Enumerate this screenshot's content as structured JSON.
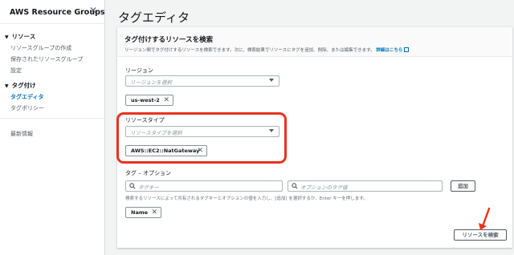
{
  "sidebar": {
    "title": "AWS Resource Groups",
    "sections": [
      {
        "label": "リソース",
        "items": [
          "リソースグループの作成",
          "保存されたリソースグループ",
          "設定"
        ]
      },
      {
        "label": "タグ付け",
        "items": [
          "タグエディタ",
          "タグポリシー"
        ]
      }
    ],
    "footer_item": "最新情報"
  },
  "page": {
    "title": "タグエディタ"
  },
  "panel": {
    "title": "タグ付けするリソースを検索",
    "description": "リージョン間でタグ付けするリソースを検索できます。次に、検索結果でリソースにタグを追加、削除、または編集できます。",
    "link": "詳細はこちら"
  },
  "region": {
    "label": "リージョン",
    "placeholder": "リージョンを選択",
    "token": "us-west-2"
  },
  "resource_type": {
    "label": "リソースタイプ",
    "placeholder": "リソースタイプを選択",
    "token": "AWS::EC2::NatGateway"
  },
  "tags": {
    "label": "タグ – オプション",
    "key_placeholder": "タグキー",
    "value_placeholder": "オプションのタグ値",
    "add_button": "追加",
    "hint": "検索するリソースによって共有されるタグキーとオプションの値を入力し、[追加] を選択するか、Enter キーを押します。",
    "token": "Name"
  },
  "search_button": "リソースを検索",
  "colors": {
    "highlight": "#e8331c",
    "link": "#0073bb"
  }
}
